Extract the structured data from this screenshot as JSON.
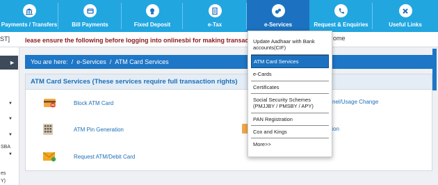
{
  "nav": {
    "items": [
      {
        "label": "Payments / Transfers",
        "icon": "bank-icon"
      },
      {
        "label": "Bill Payments",
        "icon": "bill-icon"
      },
      {
        "label": "Fixed Deposit",
        "icon": "deposit-icon"
      },
      {
        "label": "e-Tax",
        "icon": "tax-icon"
      },
      {
        "label": "e-Services",
        "icon": "services-icon"
      },
      {
        "label": "Request & Enquiries",
        "icon": "phone-icon"
      },
      {
        "label": "Useful Links",
        "icon": "links-icon"
      }
    ],
    "active_index": 4,
    "bg_color": "#21a6e0",
    "active_color": "#1c72c0"
  },
  "alert": {
    "left_fragment": "ST]",
    "message": "lease ensure the following before logging into onlinesbi for making transactions .",
    "right_fragment": "ome"
  },
  "sidebar": {
    "fragments": [
      "SBA",
      "es",
      "Y)"
    ]
  },
  "breadcrumb": {
    "prefix": "You are here:",
    "sep": "/",
    "items": [
      "e-Services",
      "ATM Card Services"
    ]
  },
  "panel": {
    "title": "ATM Card Services (These services require full transaction rights)",
    "services_left": [
      "Block ATM Card",
      "ATM Pin Generation",
      "Request ATM/Debit Card"
    ],
    "services_right": [
      "nel/Usage Change",
      "tion"
    ]
  },
  "dropdown": {
    "items": [
      "Update Aadhaar with Bank accounts(CIF)",
      "ATM Card Services",
      "e-Cards",
      "Certificates",
      "Social Security Schemes (PMJJBY / PMSBY / APY)",
      "PAN Registration",
      "Cox and Kings",
      "More>>"
    ],
    "selected_index": 1
  }
}
